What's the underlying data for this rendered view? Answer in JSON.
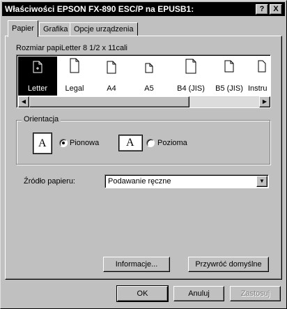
{
  "window": {
    "title": "Właściwości EPSON FX-890 ESC/P na EPUSB1:",
    "help_button": "?",
    "close_button": "X"
  },
  "tabs": [
    {
      "label": "Papier",
      "active": true
    },
    {
      "label": "Grafika",
      "active": false
    },
    {
      "label": "Opcje urządzenia",
      "active": false
    }
  ],
  "paper": {
    "size_label": "Rozmiar papiLetter 8 1/2 x 11cali",
    "sizes": [
      {
        "label": "Letter",
        "selected": true
      },
      {
        "label": "Legal",
        "selected": false
      },
      {
        "label": "A4",
        "selected": false
      },
      {
        "label": "A5",
        "selected": false
      },
      {
        "label": "B4 (JIS)",
        "selected": false
      },
      {
        "label": "B5 (JIS)",
        "selected": false
      },
      {
        "label": "Instru",
        "selected": false
      }
    ],
    "scroll_left": "◀",
    "scroll_right": "▶"
  },
  "orientation": {
    "group_label": "Orientacja",
    "portrait_label": "Pionowa",
    "landscape_label": "Pozioma",
    "icon_letter": "A",
    "selected": "portrait"
  },
  "source": {
    "label": "Źródło papieru:",
    "value": "Podawanie ręczne",
    "arrow": "▼"
  },
  "panel_buttons": {
    "info": "Informacje...",
    "restore": "Przywróć domyślne"
  },
  "dialog_buttons": {
    "ok": "OK",
    "cancel": "Anuluj",
    "apply": "Zastosuj"
  },
  "colors": {
    "face": "#c0c0c0",
    "titlebar": "#000000",
    "selection": "#000000"
  }
}
